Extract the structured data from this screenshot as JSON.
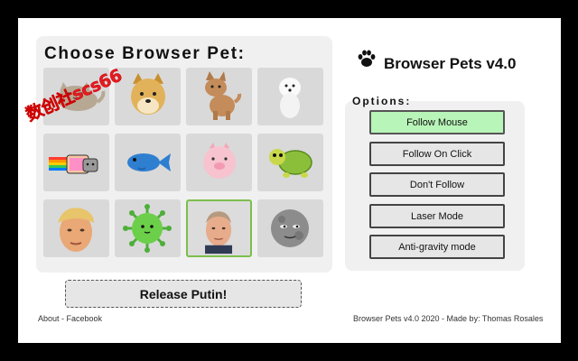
{
  "title": "Choose Browser Pet:",
  "brand": {
    "name": "Browser Pets v4.0",
    "icon": "paw-icon"
  },
  "pets": [
    {
      "name": "pusheen",
      "icon": "cat-pusheen-icon"
    },
    {
      "name": "doge",
      "icon": "doge-icon"
    },
    {
      "name": "corgi",
      "icon": "corgi-icon"
    },
    {
      "name": "white-dog",
      "icon": "white-dog-icon"
    },
    {
      "name": "nyan-cat",
      "icon": "nyan-cat-icon"
    },
    {
      "name": "blue-fish",
      "icon": "fish-icon"
    },
    {
      "name": "pig",
      "icon": "pig-icon"
    },
    {
      "name": "turtle",
      "icon": "turtle-icon"
    },
    {
      "name": "trump",
      "icon": "trump-face-icon"
    },
    {
      "name": "virus",
      "icon": "virus-icon"
    },
    {
      "name": "putin",
      "icon": "putin-face-icon",
      "selected": true
    },
    {
      "name": "moon",
      "icon": "moon-face-icon"
    }
  ],
  "watermark": "数创社scs66",
  "release_button": "Release Putin!",
  "options": {
    "label": "Options:",
    "items": [
      {
        "label": "Follow Mouse",
        "active": true
      },
      {
        "label": "Follow On Click",
        "active": false
      },
      {
        "label": "Don't Follow",
        "active": false
      },
      {
        "label": "Laser Mode",
        "active": false
      },
      {
        "label": "Anti-gravity mode",
        "active": false
      }
    ]
  },
  "footer": {
    "about": "About",
    "separator": " - ",
    "facebook": "Facebook",
    "credit": "Browser Pets v4.0 2020 - Made by: Thomas Rosales"
  },
  "colors": {
    "selected_border": "#7cbf4d",
    "active_option": "#b8f5b8"
  }
}
